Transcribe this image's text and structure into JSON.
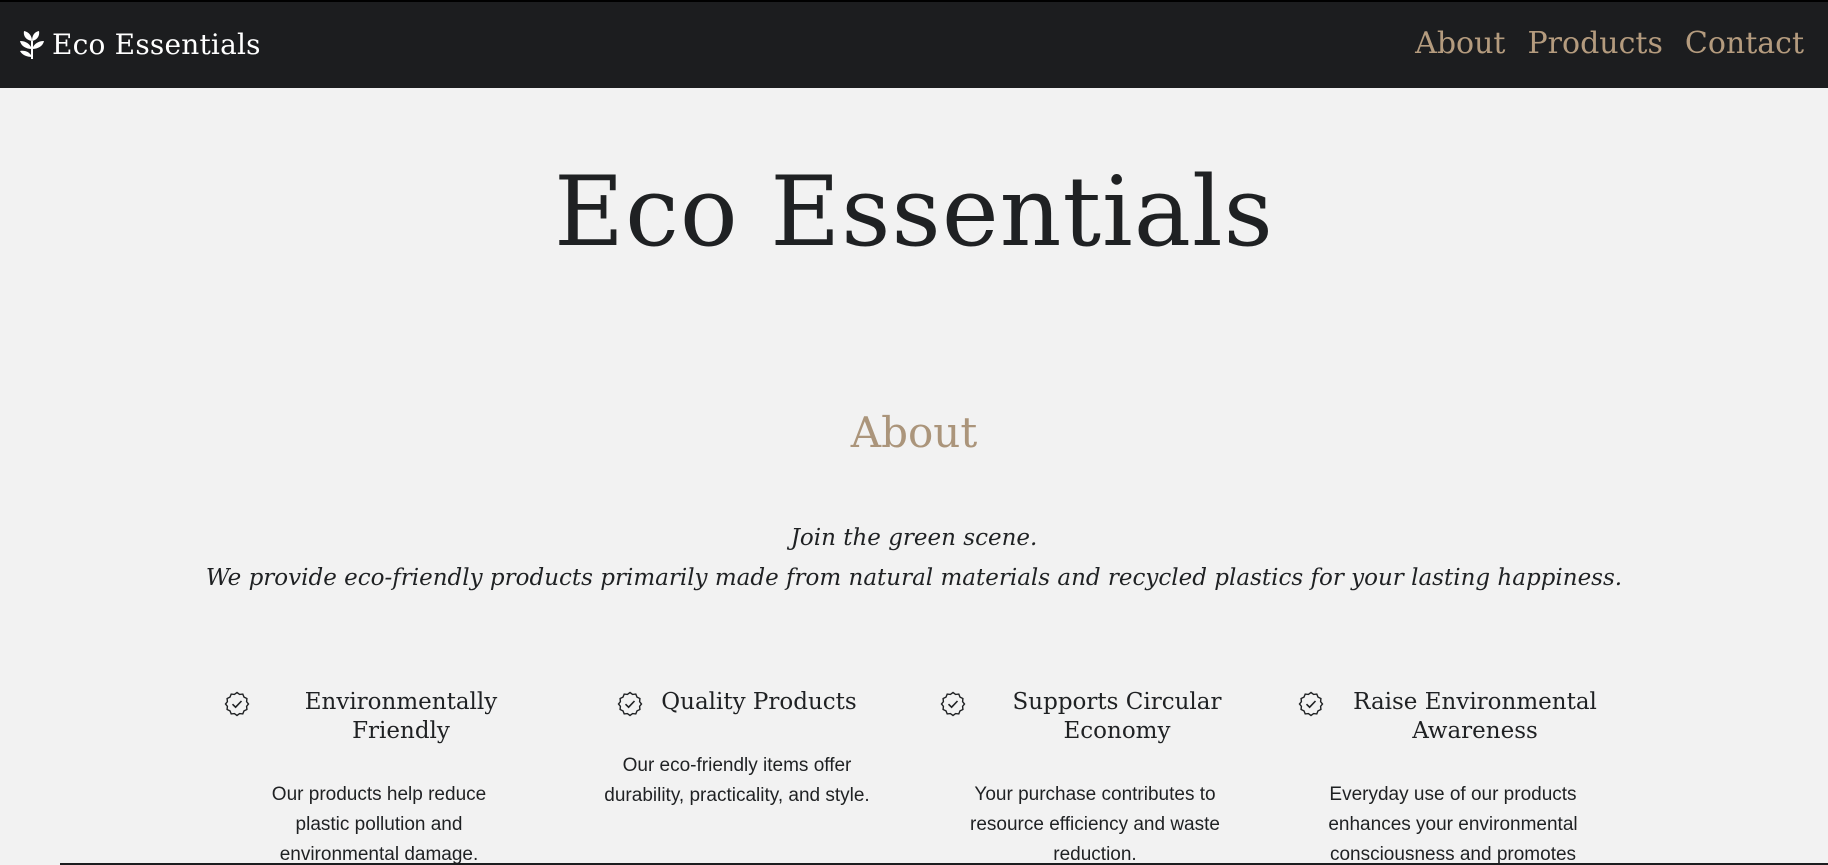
{
  "header": {
    "brand": "Eco Essentials",
    "nav": [
      "About",
      "Products",
      "Contact"
    ]
  },
  "hero": {
    "title": "Eco Essentials"
  },
  "about": {
    "heading": "About",
    "tagline_line1": "Join the green scene.",
    "tagline_line2": "We provide eco-friendly products primarily made from natural materials and recycled plastics for your lasting happiness."
  },
  "features": [
    {
      "icon": "check-badge-icon",
      "title": "Environmentally Friendly",
      "text": "Our products help reduce plastic pollution and environmental damage."
    },
    {
      "icon": "check-badge-icon",
      "title": "Quality Products",
      "text": "Our eco-friendly items offer durability, practicality, and style."
    },
    {
      "icon": "check-badge-icon",
      "title": "Supports Circular Economy",
      "text": "Your purchase contributes to resource efficiency and waste reduction."
    },
    {
      "icon": "check-badge-icon",
      "title": "Raise Environmental Awareness",
      "text": "Everyday use of our products enhances your environmental consciousness and promotes"
    }
  ],
  "colors": {
    "header_bg": "#1c1d1f",
    "accent": "#b49b7e",
    "page_bg": "#f2f2f2",
    "text": "#1f2123"
  }
}
